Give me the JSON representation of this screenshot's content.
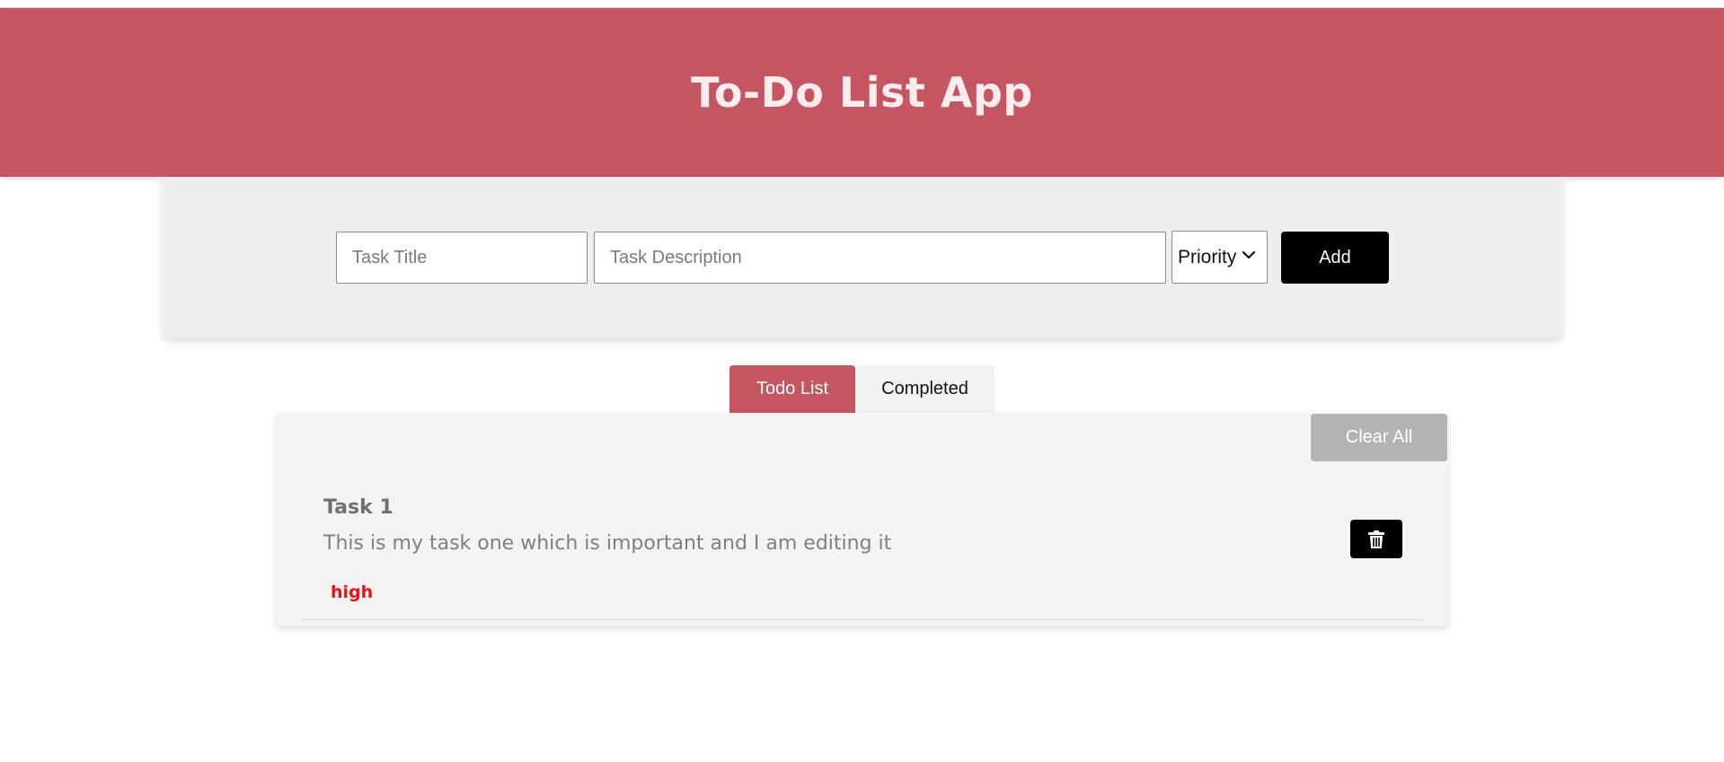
{
  "header": {
    "title": "To-Do List App",
    "background": "#c55661"
  },
  "form": {
    "title_input": {
      "placeholder": "Task Title",
      "value": ""
    },
    "description_input": {
      "placeholder": "Task Description",
      "value": ""
    },
    "priority_select": {
      "selected": "Priority"
    },
    "add_label": "Add"
  },
  "tabs": [
    {
      "label": "Todo List",
      "active": true
    },
    {
      "label": "Completed",
      "active": false
    }
  ],
  "list": {
    "clear_all_label": "Clear All",
    "tasks": [
      {
        "title": "Task 1",
        "description": "This is my task one which is important and I am editing it",
        "priority": "high",
        "priority_color": "#ee1111",
        "delete_icon": "trash-icon"
      }
    ]
  },
  "colors": {
    "accent": "#c55661",
    "button_dark": "#000000",
    "button_disabled": "#b3b3b3"
  }
}
